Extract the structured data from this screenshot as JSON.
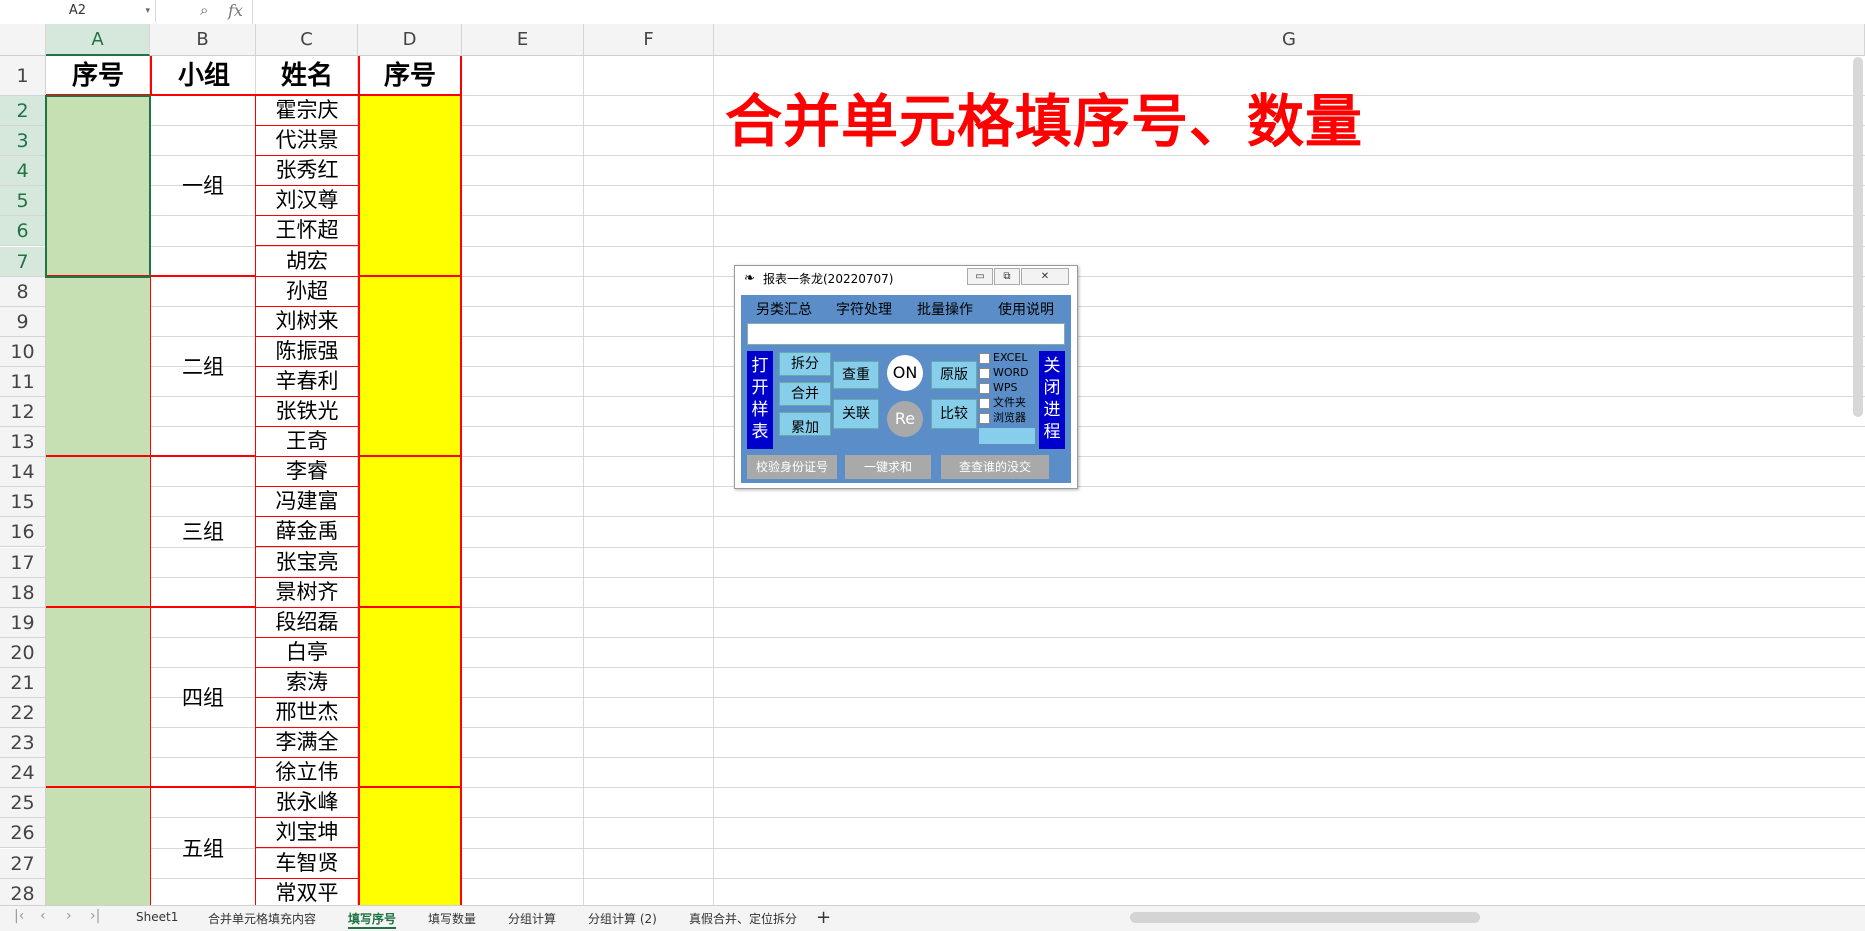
{
  "formula_bar": {
    "name_box": "A2",
    "fx": "fx"
  },
  "columns": [
    "A",
    "B",
    "C",
    "D",
    "E",
    "F",
    "G"
  ],
  "rows": [
    "1",
    "2",
    "3",
    "4",
    "5",
    "6",
    "7",
    "8",
    "9",
    "10",
    "11",
    "12",
    "13",
    "14",
    "15",
    "16",
    "17",
    "18",
    "19",
    "20",
    "21",
    "22",
    "23",
    "24",
    "25",
    "26",
    "27",
    "28"
  ],
  "headers": {
    "a": "序号",
    "b": "小组",
    "c": "姓名",
    "d": "序号"
  },
  "groups": [
    {
      "label": "一组",
      "members": [
        "霍宗庆",
        "代洪景",
        "张秀红",
        "刘汉尊",
        "王怀超",
        "胡宏"
      ]
    },
    {
      "label": "二组",
      "members": [
        "孙超",
        "刘树来",
        "陈振强",
        "辛春利",
        "张铁光",
        "王奇"
      ]
    },
    {
      "label": "三组",
      "members": [
        "李睿",
        "冯建富",
        "薛金禹",
        "张宝亮",
        "景树齐"
      ]
    },
    {
      "label": "四组",
      "members": [
        "段绍磊",
        "白亭",
        "索涛",
        "邢世杰",
        "李满全",
        "徐立伟"
      ]
    },
    {
      "label": "五组",
      "members": [
        "张永峰",
        "刘宝坤",
        "车智贤",
        "常双平"
      ]
    }
  ],
  "title": "合并单元格填序号、数量",
  "dialog": {
    "title": "报表一条龙(20220707)",
    "menus": [
      "另类汇总",
      "字符处理",
      "批量操作",
      "使用说明"
    ],
    "open_sample": "打开样表",
    "close_process": "关闭进程",
    "buttons": {
      "split": "拆分",
      "merge": "合并",
      "accumulate": "累加",
      "dedupe": "查重",
      "link": "关联",
      "on": "ON",
      "re": "Re",
      "original": "原版",
      "compare": "比较"
    },
    "checks": [
      "EXCEL",
      "WORD",
      "WPS",
      "文件夹",
      "浏览器"
    ],
    "bottom_buttons": [
      "校验身份证号",
      "一键求和",
      "查查谁的没交"
    ]
  },
  "tabs": [
    "Sheet1",
    "合并单元格填充内容",
    "填写序号",
    "填写数量",
    "分组计算",
    "分组计算 (2)",
    "真假合并、定位拆分"
  ],
  "active_tab": "填写序号",
  "add_tab": "+"
}
